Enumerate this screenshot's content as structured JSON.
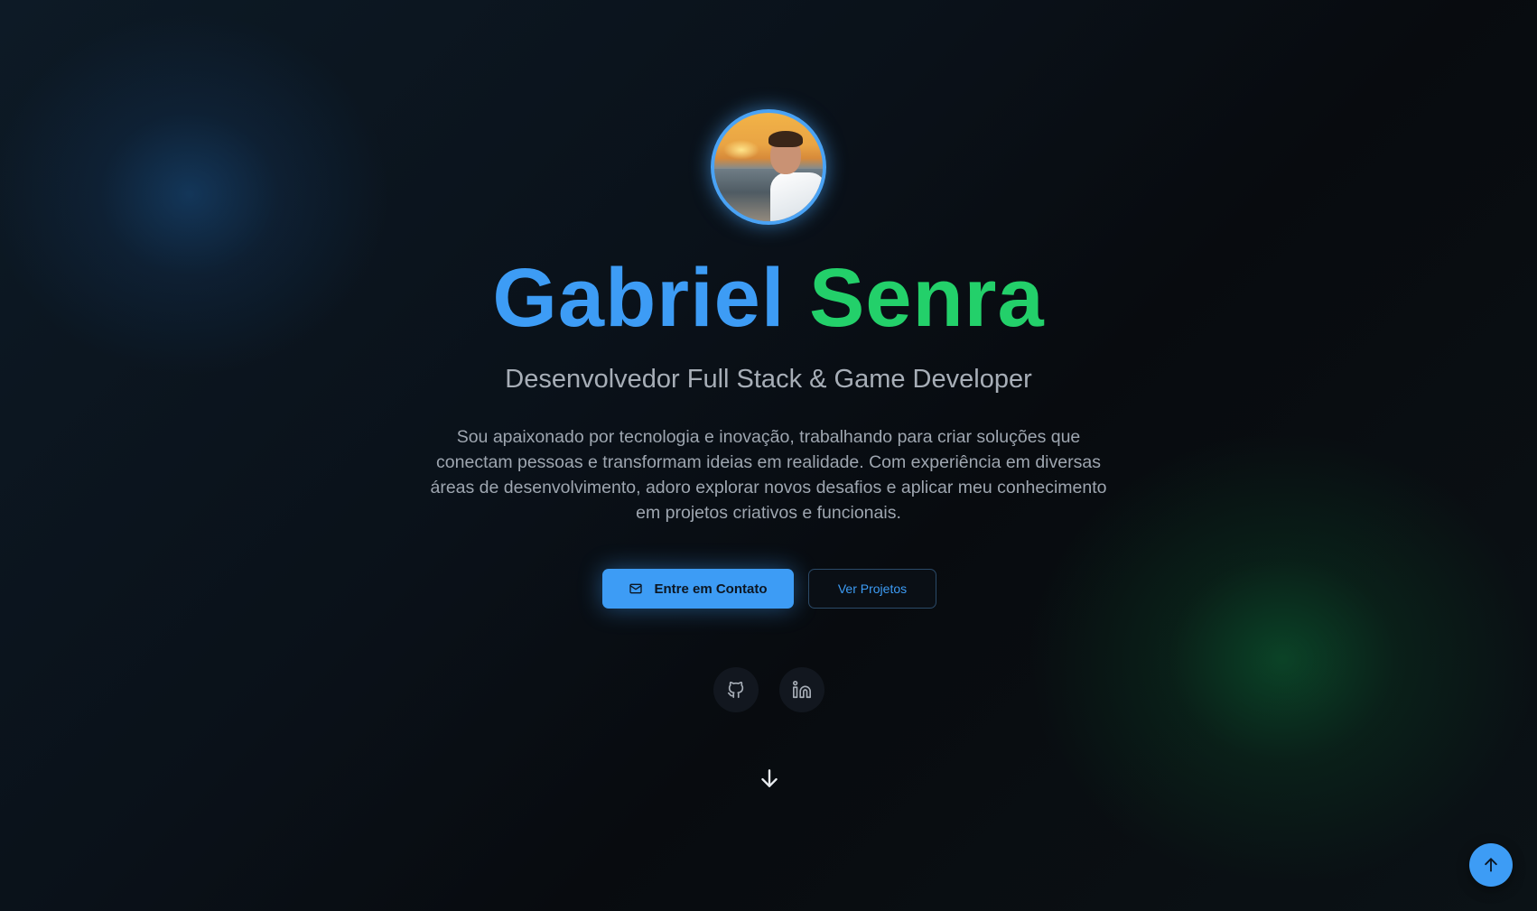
{
  "profile": {
    "avatar_alt": "Gabriel Senra",
    "first_name": "Gabriel",
    "last_name": "Senra",
    "role": "Desenvolvedor Full Stack & Game Developer",
    "bio": "Sou apaixonado por tecnologia e inovação, trabalhando para criar soluções que conectam pessoas e transformam ideias em realidade. Com experiência em diversas áreas de desenvolvimento, adoro explorar novos desafios e aplicar meu conhecimento em projetos criativos e funcionais."
  },
  "actions": {
    "contact_label": "Entre em Contato",
    "contact_icon": "mail-icon",
    "projects_label": "Ver Projetos"
  },
  "social": [
    {
      "name": "GitHub",
      "icon": "github-icon"
    },
    {
      "name": "LinkedIn",
      "icon": "linkedin-icon"
    }
  ],
  "navigation": {
    "scroll_down_icon": "arrow-down-icon",
    "back_to_top_icon": "arrow-up-icon"
  },
  "colors": {
    "accent_blue": "#3d9cf5",
    "accent_green": "#23d06a",
    "background": "#0b0f14"
  }
}
